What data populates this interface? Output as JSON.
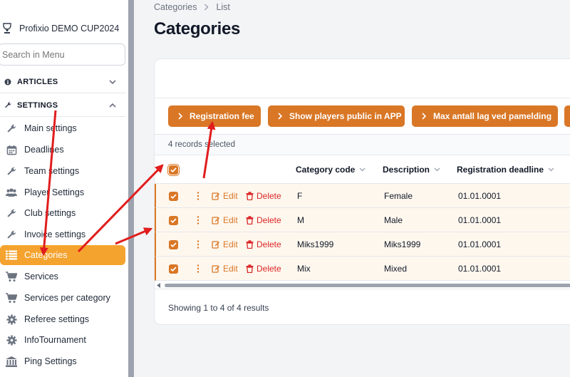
{
  "sidebar": {
    "brand": "Profixio DEMO CUP2024",
    "search_placeholder": "Search in Menu",
    "groups": {
      "articles": "ARTICLES",
      "settings": "SETTINGS"
    },
    "items": [
      {
        "label": "Main settings",
        "icon": "wrench-icon"
      },
      {
        "label": "Deadlines",
        "icon": "calendar-icon"
      },
      {
        "label": "Team settings",
        "icon": "wrench-icon"
      },
      {
        "label": "Player Settings",
        "icon": "users-icon"
      },
      {
        "label": "Club settings",
        "icon": "wrench-icon"
      },
      {
        "label": "Invoice settings",
        "icon": "wrench-icon"
      },
      {
        "label": "Categories",
        "icon": "list-icon",
        "active": true
      },
      {
        "label": "Services",
        "icon": "cart-icon"
      },
      {
        "label": "Services per category",
        "icon": "cart-icon"
      },
      {
        "label": "Referee settings",
        "icon": "gear-icon"
      },
      {
        "label": "InfoTournament",
        "icon": "gear-icon"
      },
      {
        "label": "Ping Settings",
        "icon": "bank-icon"
      }
    ]
  },
  "breadcrumb": {
    "first": "Categories",
    "second": "List"
  },
  "page_title": "Categories",
  "actions": {
    "registration_fee": "Registration fee",
    "show_players": "Show players public in APP",
    "max_teams": "Max antall lag ved pamelding"
  },
  "selection_text": "4 records selected",
  "table": {
    "headers": {
      "code": "Category code",
      "description": "Description",
      "deadline": "Registration deadline"
    },
    "edit_label": "Edit",
    "delete_label": "Delete",
    "rows": [
      {
        "code": "F",
        "description": "Female",
        "deadline": "01.01.0001"
      },
      {
        "code": "M",
        "description": "Male",
        "deadline": "01.01.0001"
      },
      {
        "code": "Miks1999",
        "description": "Miks1999",
        "deadline": "01.01.0001"
      },
      {
        "code": "Mix",
        "description": "Mixed",
        "deadline": "01.01.0001"
      }
    ]
  },
  "footer": "Showing 1 to 4 of 4 results",
  "colors": {
    "accent": "#d97726",
    "active_nav": "#f5a32f",
    "danger": "#dc2626",
    "annotation_arrow": "#e11d1d"
  }
}
